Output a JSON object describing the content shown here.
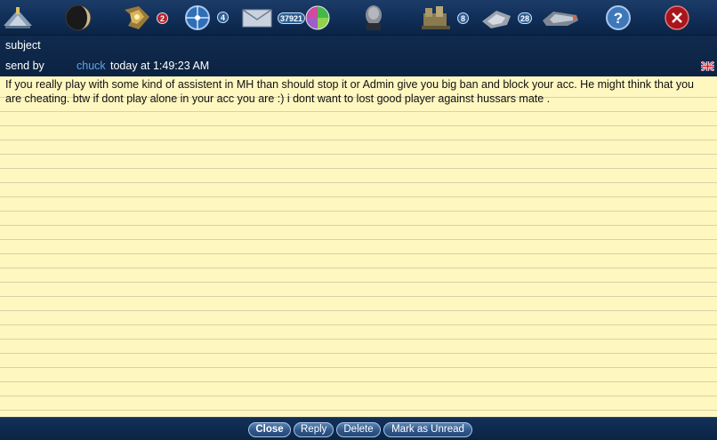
{
  "toolbar": {
    "items": [
      {
        "icon": "fleet-icon"
      },
      {
        "icon": "planet-icon"
      },
      {
        "icon": "ships-icon",
        "badge": "2",
        "badge_color": "#b8232a"
      },
      {
        "icon": "galaxy-map-icon",
        "badge": "4",
        "badge_color": "#2c5f95"
      },
      {
        "icon": "mail-icon",
        "badge": "37921",
        "badge_color": "#2c5f95"
      },
      {
        "icon": "resources-orb-icon"
      },
      {
        "icon": "commander-icon"
      },
      {
        "icon": "factory-icon",
        "badge": "8",
        "badge_color": "#2c5f95"
      },
      {
        "icon": "shipyard-icon",
        "badge": "28",
        "badge_color": "#2c5f95"
      },
      {
        "icon": "battleship-icon"
      },
      {
        "icon": "help-icon"
      },
      {
        "icon": "close-icon"
      }
    ]
  },
  "message": {
    "subject_label": "subject",
    "sendby_label": "send by",
    "sender": "chuck",
    "time": "today at 1:49:23 AM",
    "flag_icon": "uk-flag-icon",
    "body": "If you really play with some kind of assistent in MH than should stop it or Admin give you big ban and block your acc. He might think that you are cheating. btw if dont play alone in your acc you are :) i dont want to lost good player against hussars mate ."
  },
  "actions": {
    "close": "Close",
    "reply": "Reply",
    "delete": "Delete",
    "mark_unread": "Mark as Unread"
  },
  "colors": {
    "toolbar_bg": "#12305a",
    "paper": "#fff7c0",
    "sender_link": "#5fa3e6",
    "badge_red": "#b8232a"
  }
}
